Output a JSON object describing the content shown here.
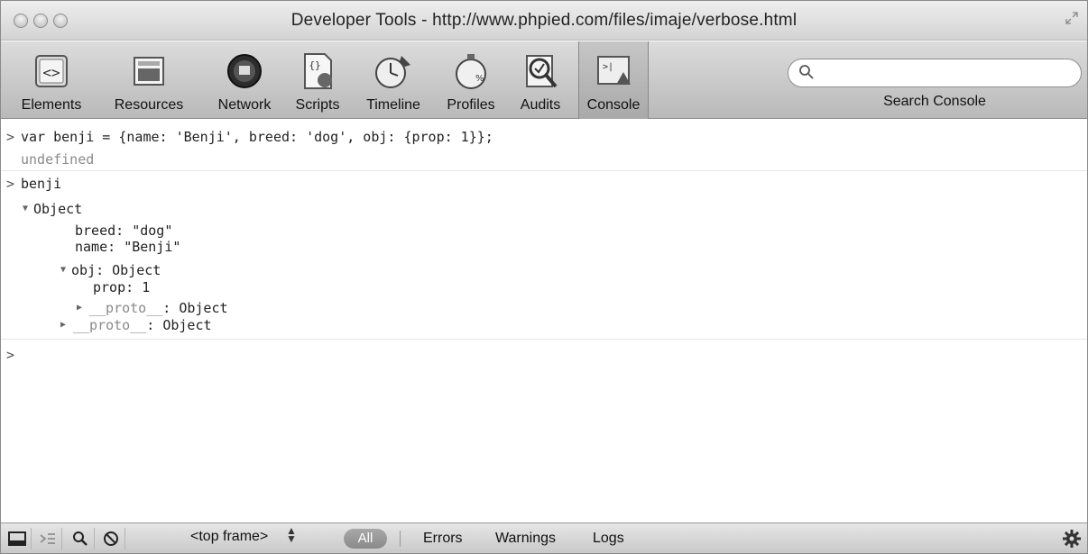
{
  "window": {
    "title": "Developer Tools - http://www.phpied.com/files/imaje/verbose.html"
  },
  "toolbar": {
    "tools": [
      {
        "label": "Elements",
        "icon": "elements-icon"
      },
      {
        "label": "Resources",
        "icon": "resources-icon"
      },
      {
        "label": "Network",
        "icon": "network-icon"
      },
      {
        "label": "Scripts",
        "icon": "scripts-icon"
      },
      {
        "label": "Timeline",
        "icon": "timeline-icon"
      },
      {
        "label": "Profiles",
        "icon": "profiles-icon"
      },
      {
        "label": "Audits",
        "icon": "audits-icon"
      },
      {
        "label": "Console",
        "icon": "console-icon",
        "selected": true
      }
    ],
    "search": {
      "placeholder": "",
      "value": "",
      "label": "Search Console"
    }
  },
  "console": {
    "entry1": {
      "input": "var benji = {name: 'Benji', breed: 'dog', obj: {prop: 1}};",
      "result": "undefined"
    },
    "entry2": {
      "input": "benji",
      "tree": {
        "root": "Object",
        "breed_key": "breed",
        "breed_value": "\"dog\"",
        "name_key": "name",
        "name_value": "\"Benji\"",
        "obj_key": "obj",
        "obj_value": "Object",
        "prop_key": "prop",
        "prop_value": "1",
        "proto_key": "__proto__",
        "proto_value": "Object"
      }
    },
    "prompt": ">"
  },
  "statusbar": {
    "frame": "<top frame>",
    "filters": {
      "all": "All",
      "errors": "Errors",
      "warnings": "Warnings",
      "logs": "Logs"
    }
  }
}
